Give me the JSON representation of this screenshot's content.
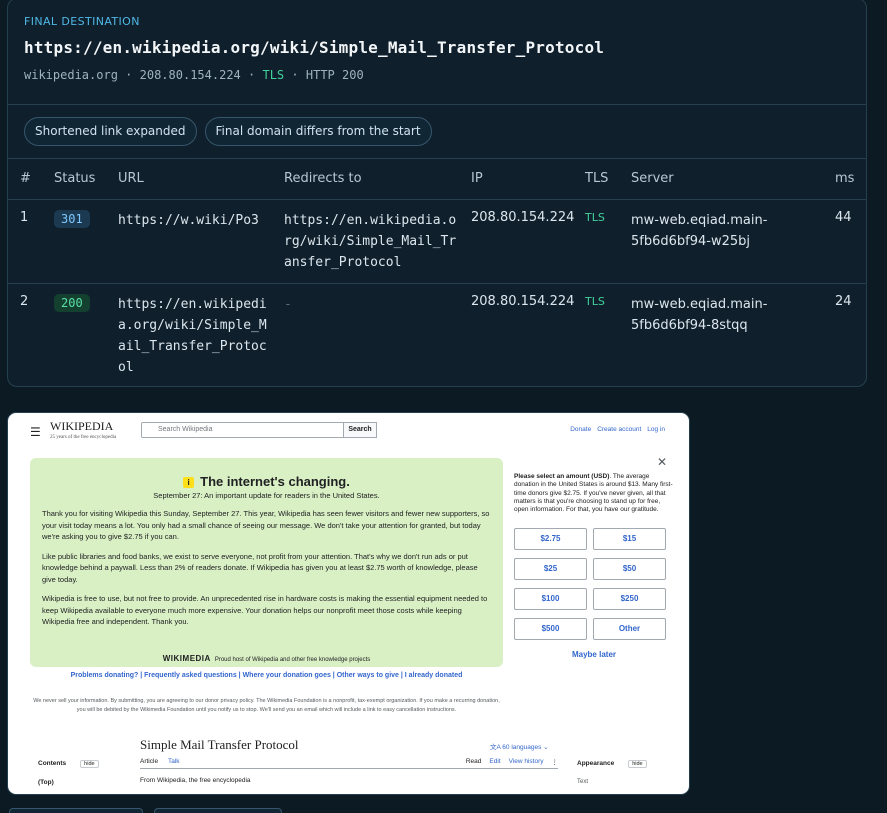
{
  "destination": {
    "label": "FINAL DESTINATION",
    "url": "https://en.wikipedia.org/wiki/Simple_Mail_Transfer_Protocol",
    "domain": "wikipedia.org",
    "ip": "208.80.154.224",
    "tls": "TLS",
    "http": "HTTP 200",
    "sep": "·"
  },
  "chips": [
    "Shortened link expanded",
    "Final domain differs from the start"
  ],
  "table": {
    "headers": [
      "#",
      "Status",
      "URL",
      "Redirects to",
      "IP",
      "TLS",
      "Server",
      "ms"
    ],
    "rows": [
      {
        "num": "1",
        "status": "301",
        "url": "https://w.wiki/Po3",
        "redirect": "https://en.wikipedia.org/wiki/Simple_Mail_Transfer_Protocol",
        "ip": "208.80.154.224",
        "tls": "TLS",
        "server": "mw-web.eqiad.main-5fb6d6bf94-w25bj",
        "ms": "44"
      },
      {
        "num": "2",
        "status": "200",
        "url": "https://en.wikipedia.org/wiki/Simple_Mail_Transfer_Protocol",
        "redirect": "-",
        "ip": "208.80.154.224",
        "tls": "TLS",
        "server": "mw-web.eqiad.main-5fb6d6bf94-8stqq",
        "ms": "24"
      }
    ]
  },
  "screenshot": {
    "logo": "WIKIPEDIA",
    "logo_sub": "25 years of the free encyclopedia",
    "search_placeholder": "Search Wikipedia",
    "search_button": "Search",
    "top_links": [
      "Donate",
      "Create account",
      "Log in"
    ],
    "banner_title": "The internet's changing.",
    "banner_sub": "September 27: An important update for readers in the United States.",
    "banner_p1": "Thank you for visiting Wikipedia this Sunday, September 27. This year, Wikipedia has seen fewer visitors and fewer new supporters, so your visit today means a lot. You only had a small chance of seeing our message. We don't take your attention for granted, but today we're asking you to give $2.75 if you can.",
    "banner_p2": "Like public libraries and food banks, we exist to serve everyone, not profit from your attention. That's why we don't run ads or put knowledge behind a paywall. Less than 2% of readers donate. If Wikipedia has given you at least $2.75 worth of knowledge, please give today.",
    "banner_p3": "Wikipedia is free to use, but not free to provide. An unprecedented rise in hardware costs is making the essential equipment needed to keep Wikipedia available to everyone much more expensive. Your donation helps our nonprofit meet those costs while keeping Wikipedia free and independent. Thank you.",
    "banner_foot_logo": "WIKIMEDIA",
    "banner_foot": "Proud host of Wikipedia and other free knowledge projects",
    "donate_bold": "Please select an amount (USD)",
    "donate_text": ". The average donation in the United States is around $13. Many first-time donors give $2.75. If you've never given, all that matters is that you're choosing to stand up for free, open information. For that, you have our gratitude.",
    "amounts": [
      "$2.75",
      "$15",
      "$25",
      "$50",
      "$100",
      "$250",
      "$500",
      "Other"
    ],
    "maybe_later": "Maybe later",
    "faq": "Problems donating? | Frequently asked questions | Where your donation goes | Other ways to give | I already donated",
    "legal": "We never sell your information. By submitting, you are agreeing to our donor privacy policy. The Wikimedia Foundation is a nonprofit, tax-exempt organization. If you make a recurring donation, you will be debited by the Wikimedia Foundation until you notify us to stop. We'll send you an email which will include a link to easy cancellation instructions.",
    "article_title": "Simple Mail Transfer Protocol",
    "languages": "60 languages",
    "tab_article": "Article",
    "tab_talk": "Talk",
    "tabs_right": [
      "Read",
      "Edit",
      "View history"
    ],
    "from": "From Wikipedia, the free encyclopedia",
    "contents": "Contents",
    "hide": "hide",
    "top": "(Top)",
    "appearance": "Appearance",
    "text": "Text"
  }
}
